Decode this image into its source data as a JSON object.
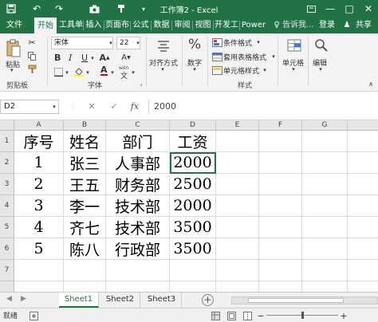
{
  "window": {
    "title": "工作簿2 - Excel",
    "accent_color": "#217346"
  },
  "quick_access": [
    "save-icon",
    "undo-icon",
    "redo-icon",
    "camera-icon",
    "brush-icon",
    "customize-dropdown-icon"
  ],
  "ribbon_tabs": [
    {
      "label": "文件"
    },
    {
      "label": "开始"
    },
    {
      "label": "工具单"
    },
    {
      "label": "插入"
    },
    {
      "label": "页面布"
    },
    {
      "label": "公式"
    },
    {
      "label": "数据"
    },
    {
      "label": "审阅"
    },
    {
      "label": "视图"
    },
    {
      "label": "开发工"
    },
    {
      "label": "Power"
    }
  ],
  "tell_me": "告诉我...",
  "login": "登录",
  "share": "共享",
  "ribbon": {
    "paste": "粘贴",
    "clipboard_label": "剪贴板",
    "font_name": "宋体",
    "font_size": "22",
    "bold": "B",
    "italic": "I",
    "underline": "U",
    "font_color_letter": "A",
    "wen": "wén",
    "font_label": "字体",
    "alignment": "对齐方式",
    "number": "数字",
    "percent_symbol": "%",
    "conditional_format": "条件格式",
    "table_format": "套用表格格式",
    "cell_styles": "单元格样式",
    "styles_label": "样式",
    "cells": "单元格",
    "editing": "编辑"
  },
  "formula_bar": {
    "name_box": "D2",
    "fx": "fx",
    "value": "2000"
  },
  "columns": [
    "A",
    "B",
    "C",
    "D",
    "E",
    "F",
    "G"
  ],
  "rows": [
    "1",
    "2",
    "3",
    "4",
    "5",
    "6",
    "7"
  ],
  "cells": [
    [
      "序号",
      "姓名",
      "部门",
      "工资"
    ],
    [
      "1",
      "张三",
      "人事部",
      "2000"
    ],
    [
      "2",
      "王五",
      "财务部",
      "2500"
    ],
    [
      "3",
      "李一",
      "技术部",
      "2000"
    ],
    [
      "4",
      "齐七",
      "技术部",
      "3500"
    ],
    [
      "5",
      "陈八",
      "行政部",
      "3500"
    ]
  ],
  "sheets": [
    {
      "label": "Sheet1",
      "active": true
    },
    {
      "label": "Sheet2",
      "active": false
    },
    {
      "label": "Sheet3",
      "active": false
    }
  ],
  "status": {
    "ready": "就绪"
  }
}
